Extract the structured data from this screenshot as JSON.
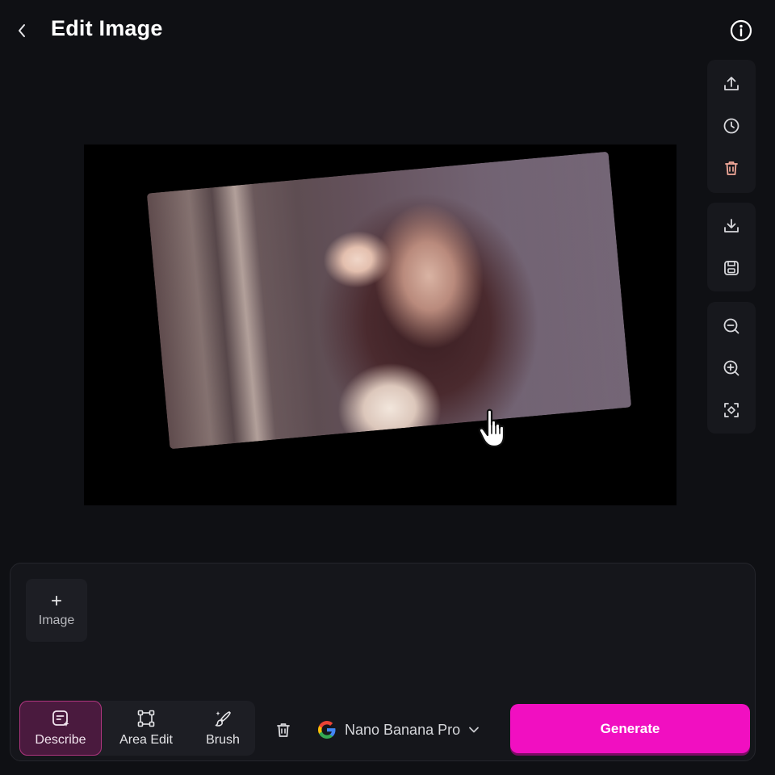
{
  "header": {
    "title": "Edit Image"
  },
  "upload": {
    "label": "Image"
  },
  "modes": [
    {
      "label": "Describe",
      "icon": "describe-icon",
      "active": true
    },
    {
      "label": "Area Edit",
      "icon": "area-edit-icon",
      "active": false
    },
    {
      "label": "Brush",
      "icon": "brush-icon",
      "active": false
    }
  ],
  "model": {
    "name": "Nano Banana Pro",
    "icon": "google-logo"
  },
  "generate": {
    "label": "Generate"
  },
  "colors": {
    "accent": "#f10fc1",
    "active_mode_bg": "#4a1a3e",
    "active_mode_border": "#b0357f",
    "background": "#0f1014"
  }
}
